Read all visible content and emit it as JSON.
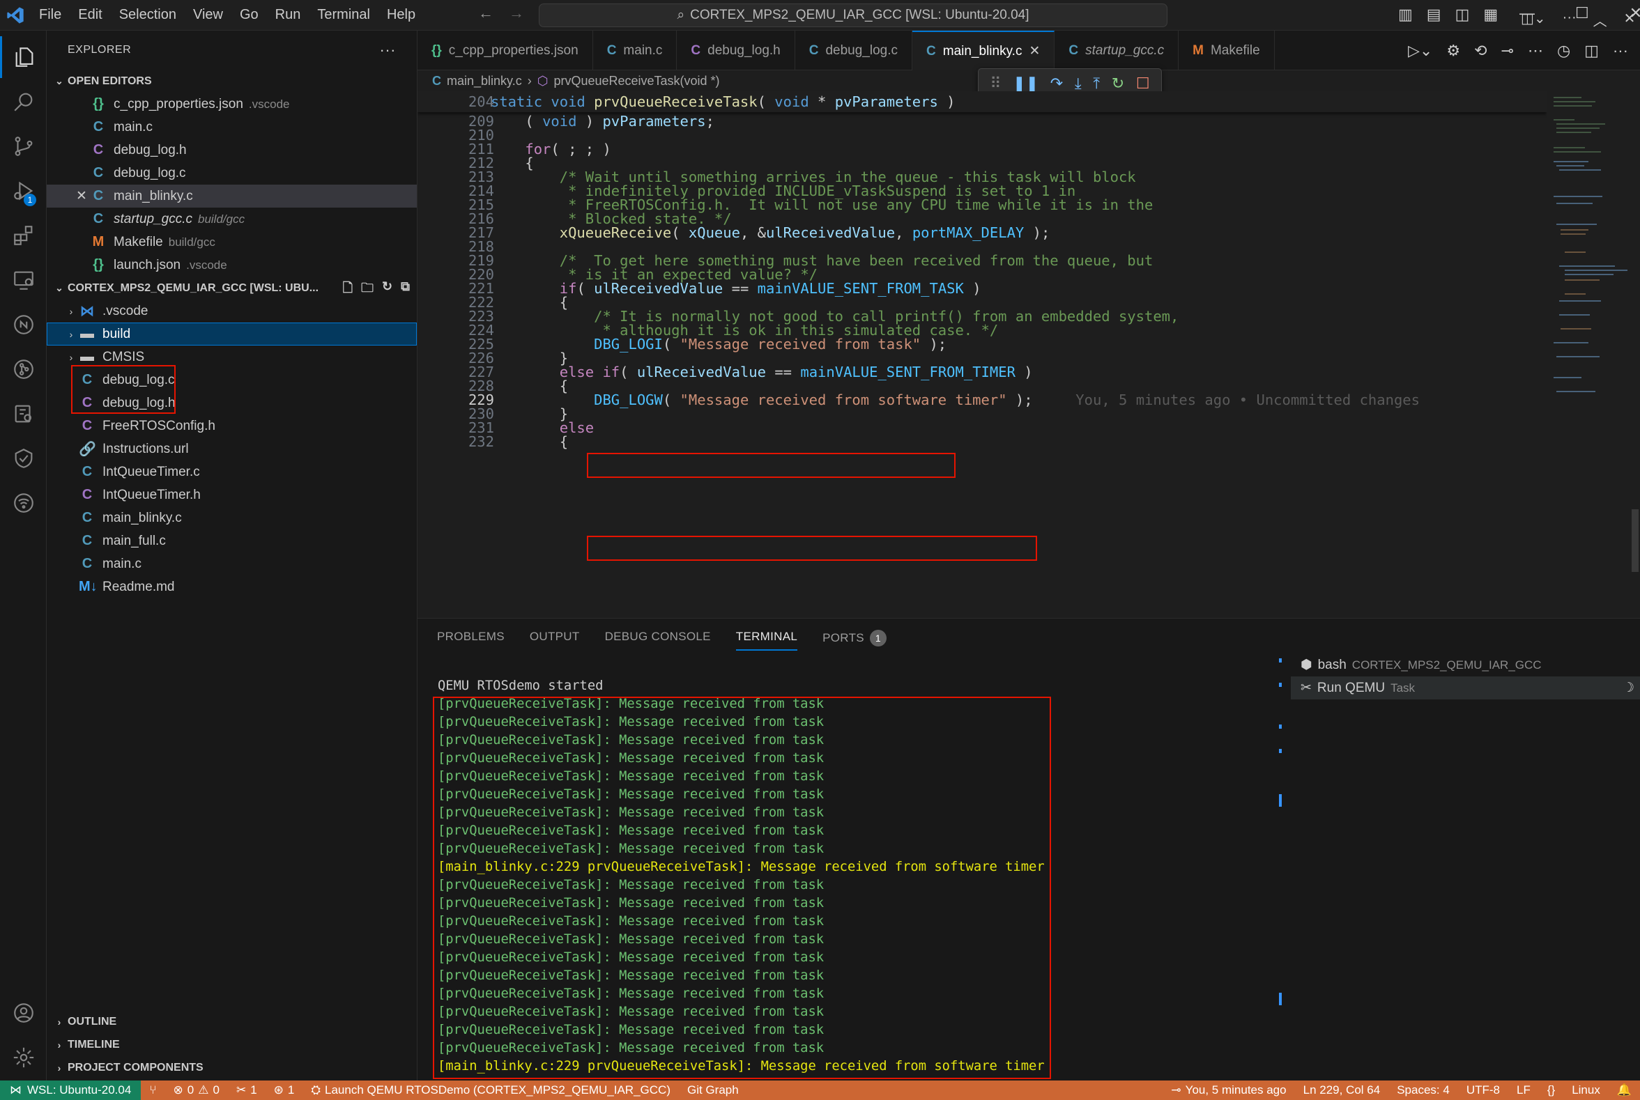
{
  "titlebar": {
    "menu": [
      "File",
      "Edit",
      "Selection",
      "View",
      "Go",
      "Run",
      "Terminal",
      "Help"
    ],
    "command_center": "CORTEX_MPS2_QEMU_IAR_GCC [WSL: Ubuntu-20.04]"
  },
  "activity": {
    "debug_badge": "1"
  },
  "sidebar": {
    "title": "EXPLORER",
    "open_editors_header": "OPEN EDITORS",
    "open_editors": [
      {
        "name": "c_cpp_properties.json",
        "hint": ".vscode",
        "icon": "json"
      },
      {
        "name": "main.c",
        "hint": "",
        "icon": "c"
      },
      {
        "name": "debug_log.h",
        "hint": "",
        "icon": "c"
      },
      {
        "name": "debug_log.c",
        "hint": "",
        "icon": "c"
      },
      {
        "name": "main_blinky.c",
        "hint": "",
        "icon": "c"
      },
      {
        "name": "startup_gcc.c",
        "hint": "build/gcc",
        "icon": "c"
      },
      {
        "name": "Makefile",
        "hint": "build/gcc",
        "icon": "make"
      },
      {
        "name": "launch.json",
        "hint": ".vscode",
        "icon": "json"
      }
    ],
    "workspace_header": "CORTEX_MPS2_QEMU_IAR_GCC [WSL: UBU...",
    "tree": [
      {
        "name": ".vscode",
        "type": "folder"
      },
      {
        "name": "build",
        "type": "folder"
      },
      {
        "name": "CMSIS",
        "type": "folder"
      },
      {
        "name": "debug_log.c",
        "type": "c"
      },
      {
        "name": "debug_log.h",
        "type": "h"
      },
      {
        "name": "FreeRTOSConfig.h",
        "type": "h"
      },
      {
        "name": "Instructions.url",
        "type": "url"
      },
      {
        "name": "IntQueueTimer.c",
        "type": "c"
      },
      {
        "name": "IntQueueTimer.h",
        "type": "h"
      },
      {
        "name": "main_blinky.c",
        "type": "c"
      },
      {
        "name": "main_full.c",
        "type": "c"
      },
      {
        "name": "main.c",
        "type": "c"
      },
      {
        "name": "Readme.md",
        "type": "md"
      }
    ],
    "outline": "OUTLINE",
    "timeline": "TIMELINE",
    "project_components": "PROJECT COMPONENTS"
  },
  "tabs": [
    {
      "label": "c_cpp_properties.json",
      "icon": "json"
    },
    {
      "label": "main.c",
      "icon": "c"
    },
    {
      "label": "debug_log.h",
      "icon": "c"
    },
    {
      "label": "debug_log.c",
      "icon": "c"
    },
    {
      "label": "main_blinky.c",
      "icon": "c",
      "active": true
    },
    {
      "label": "startup_gcc.c",
      "icon": "c",
      "italic": true
    },
    {
      "label": "Makefile",
      "icon": "make"
    }
  ],
  "breadcrumb": {
    "file": "main_blinky.c",
    "symbol": "prvQueueReceiveTask(void *)"
  },
  "editor": {
    "sticky_line": "204",
    "lines": [
      {
        "n": "209"
      },
      {
        "n": "210"
      },
      {
        "n": "211"
      },
      {
        "n": "212"
      },
      {
        "n": "213"
      },
      {
        "n": "214"
      },
      {
        "n": "215"
      },
      {
        "n": "216"
      },
      {
        "n": "217"
      },
      {
        "n": "218"
      },
      {
        "n": "219"
      },
      {
        "n": "220"
      },
      {
        "n": "221"
      },
      {
        "n": "222"
      },
      {
        "n": "223"
      },
      {
        "n": "224"
      },
      {
        "n": "225"
      },
      {
        "n": "226"
      },
      {
        "n": "227"
      },
      {
        "n": "228"
      },
      {
        "n": "229"
      },
      {
        "n": "230"
      },
      {
        "n": "231"
      },
      {
        "n": "232"
      }
    ],
    "blame": "You, 5 minutes ago • Uncommitted changes"
  },
  "panel": {
    "tabs": [
      "PROBLEMS",
      "OUTPUT",
      "DEBUG CONSOLE",
      "TERMINAL",
      "PORTS"
    ],
    "ports_count": "1",
    "terminal_header": "QEMU RTOSdemo started",
    "task_msg": "[prvQueueReceiveTask]: Message received from task",
    "timer_msg": "[main_blinky.c:229 prvQueueReceiveTask]: Message received from software timer",
    "terminals": [
      {
        "name": "bash",
        "sub": "CORTEX_MPS2_QEMU_IAR_GCC"
      },
      {
        "name": "Run QEMU",
        "sub": "Task"
      }
    ]
  },
  "statusbar": {
    "remote": "WSL: Ubuntu-20.04",
    "errors": "0",
    "warnings": "0",
    "tools": "1",
    "ports": "1",
    "launch": "Launch QEMU RTOSDemo (CORTEX_MPS2_QEMU_IAR_GCC)",
    "git_graph": "Git Graph",
    "blame": "You, 5 minutes ago",
    "position": "Ln 229, Col 64",
    "spaces": "Spaces: 4",
    "encoding": "UTF-8",
    "eol": "LF",
    "language_braces": "{}",
    "os": "Linux"
  }
}
